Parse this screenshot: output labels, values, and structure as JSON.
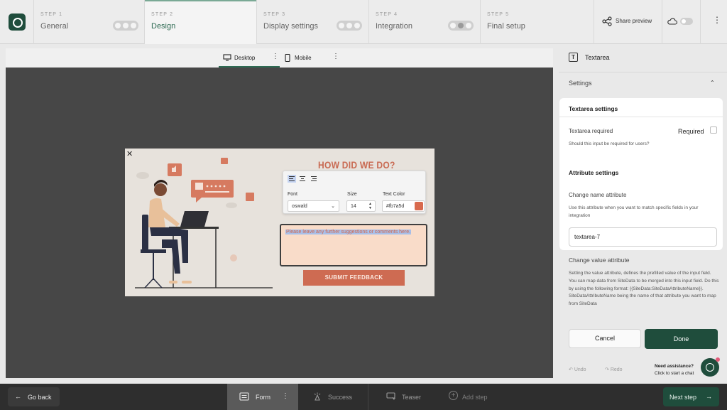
{
  "steps": [
    {
      "num": "STEP 1",
      "name": "General"
    },
    {
      "num": "STEP 2",
      "name": "Design"
    },
    {
      "num": "STEP 3",
      "name": "Display settings"
    },
    {
      "num": "STEP 4",
      "name": "Integration"
    },
    {
      "num": "STEP 5",
      "name": "Final setup"
    }
  ],
  "topbar": {
    "share_label": "Share preview"
  },
  "devices": {
    "desktop": "Desktop",
    "mobile": "Mobile"
  },
  "popup": {
    "title": "HOW DID WE DO?",
    "font_label": "Font",
    "font_value": "oswald",
    "size_label": "Size",
    "size_value": "14",
    "color_label": "Text Color",
    "color_value": "#fb7a5d",
    "placeholder": "Please leave any further suggestions or comments here.",
    "submit_label": "SUBMIT FEEDBACK"
  },
  "panel": {
    "title": "Textarea",
    "settings_label": "Settings",
    "textarea_settings": "Textarea settings",
    "textarea_required": "Textarea required",
    "required_label": "Required",
    "required_help": "Should this input be required for users?",
    "attribute_settings": "Attribute settings",
    "change_name": "Change name attribute",
    "change_name_help": "Use this attribute when you want to match specific fields in your integration",
    "name_value": "textarea-7",
    "change_value": "Change value attribute",
    "change_value_help": "Setting the value attribute, defines the prefilled value of the input field. You can map data from SiteData to be merged into this input field. Do this by using the following format: {{SiteData:SiteDataAttributeName}}. SiteDataAttributeName being the name of that attribute you want to map from SiteData",
    "cancel": "Cancel",
    "done": "Done",
    "undo": "Undo",
    "redo": "Redo",
    "need_assistance": "Need assistance?",
    "start_chat": "Click to start a chat"
  },
  "bottom": {
    "go_back": "Go back",
    "tabs": [
      "Form",
      "Success",
      "Teaser",
      "Add step"
    ],
    "next_step": "Next step"
  },
  "colors": {
    "brand": "#1f4d3c",
    "accent": "#ce6b52"
  }
}
